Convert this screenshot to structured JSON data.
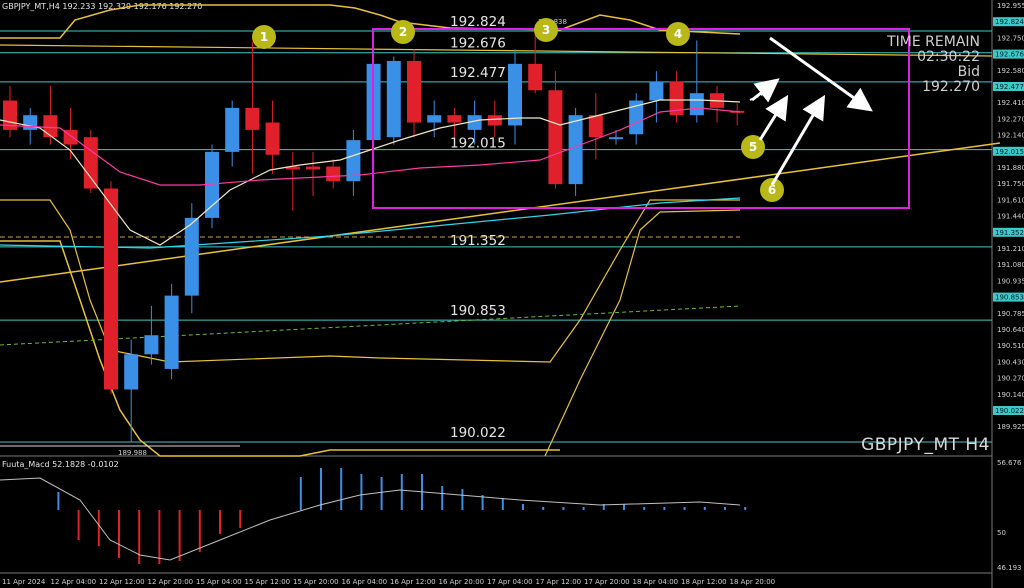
{
  "header": {
    "symbol_info": "GBPJPY_MT,H4",
    "ohlc": "192.233 192.329 192.176 192.270"
  },
  "indicator_header": {
    "name": "Fuuta_Macd",
    "values": "52.1828  -0.0102"
  },
  "info_panel": {
    "title": "TIME REMAIN",
    "countdown": "02:30:22",
    "bid_label": "Bid",
    "bid_value": "192.270"
  },
  "symbol_label": "GBPJPY_MT H4",
  "level_labels": [
    "192.824",
    "192.676",
    "192.477",
    "192.015",
    "191.352",
    "190.853",
    "190.022"
  ],
  "small_labels": {
    "top_peak": "192.838",
    "bottom_low": "189.988"
  },
  "price_axis": [
    "192.955",
    "192.824",
    "192.750",
    "192.676",
    "192.580",
    "192.477",
    "192.410",
    "192.270",
    "192.140",
    "192.015",
    "191.880",
    "191.750",
    "191.610",
    "191.440",
    "191.352",
    "191.210",
    "191.080",
    "190.935",
    "190.853",
    "190.785",
    "190.640",
    "190.510",
    "190.430",
    "190.270",
    "190.140",
    "190.022",
    "189.925"
  ],
  "indicator_axis": [
    "56.676",
    "50",
    "46.193"
  ],
  "time_axis": [
    "11 Apr 2024",
    "12 Apr 04:00",
    "12 Apr 12:00",
    "12 Apr 20:00",
    "15 Apr 04:00",
    "15 Apr 12:00",
    "15 Apr 20:00",
    "16 Apr 04:00",
    "16 Apr 12:00",
    "16 Apr 20:00",
    "17 Apr 04:00",
    "17 Apr 12:00",
    "17 Apr 20:00",
    "18 Apr 04:00",
    "18 Apr 12:00",
    "18 Apr 20:00"
  ],
  "markers": [
    "1",
    "2",
    "3",
    "4",
    "5",
    "6"
  ],
  "colors": {
    "bull": "#3a8fe6",
    "bear": "#e0202a",
    "level_line": "#3fc8c8",
    "box": "#e020e0",
    "marker": "#b8b818",
    "trend": "#e6c23a"
  },
  "chart_data": {
    "type": "candlestick",
    "symbol": "GBPJPY_MT",
    "timeframe": "H4",
    "candles": [
      {
        "o": 192.35,
        "h": 192.45,
        "l": 192.1,
        "c": 192.15
      },
      {
        "o": 192.15,
        "h": 192.3,
        "l": 192.05,
        "c": 192.25
      },
      {
        "o": 192.25,
        "h": 192.45,
        "l": 192.05,
        "c": 192.1
      },
      {
        "o": 192.15,
        "h": 192.3,
        "l": 191.95,
        "c": 192.05
      },
      {
        "o": 192.1,
        "h": 192.15,
        "l": 191.72,
        "c": 191.75
      },
      {
        "o": 191.75,
        "h": 191.8,
        "l": 190.35,
        "c": 190.38
      },
      {
        "o": 190.38,
        "h": 190.72,
        "l": 190.02,
        "c": 190.62
      },
      {
        "o": 190.62,
        "h": 190.95,
        "l": 190.55,
        "c": 190.75
      },
      {
        "o": 190.52,
        "h": 191.1,
        "l": 190.45,
        "c": 191.02
      },
      {
        "o": 191.02,
        "h": 191.65,
        "l": 190.9,
        "c": 191.55
      },
      {
        "o": 191.55,
        "h": 192.05,
        "l": 191.48,
        "c": 192.0
      },
      {
        "o": 192.0,
        "h": 192.35,
        "l": 191.9,
        "c": 192.3
      },
      {
        "o": 192.3,
        "h": 192.75,
        "l": 191.85,
        "c": 192.15
      },
      {
        "o": 192.2,
        "h": 192.35,
        "l": 191.85,
        "c": 191.98
      },
      {
        "o": 191.9,
        "h": 192.0,
        "l": 191.6,
        "c": 191.88
      },
      {
        "o": 191.9,
        "h": 192.0,
        "l": 191.7,
        "c": 191.88
      },
      {
        "o": 191.9,
        "h": 191.95,
        "l": 191.75,
        "c": 191.8
      },
      {
        "o": 191.8,
        "h": 192.15,
        "l": 191.7,
        "c": 192.08
      },
      {
        "o": 192.08,
        "h": 192.45,
        "l": 191.8,
        "c": 192.6
      },
      {
        "o": 192.1,
        "h": 192.65,
        "l": 192.05,
        "c": 192.62
      },
      {
        "o": 192.62,
        "h": 192.7,
        "l": 192.1,
        "c": 192.2
      },
      {
        "o": 192.2,
        "h": 192.35,
        "l": 192.1,
        "c": 192.25
      },
      {
        "o": 192.25,
        "h": 192.3,
        "l": 192.1,
        "c": 192.2
      },
      {
        "o": 192.15,
        "h": 192.35,
        "l": 192.05,
        "c": 192.25
      },
      {
        "o": 192.25,
        "h": 192.35,
        "l": 192.1,
        "c": 192.18
      },
      {
        "o": 192.18,
        "h": 192.7,
        "l": 192.05,
        "c": 192.6
      },
      {
        "o": 192.6,
        "h": 192.84,
        "l": 192.4,
        "c": 192.42
      },
      {
        "o": 192.42,
        "h": 192.55,
        "l": 191.75,
        "c": 191.78
      },
      {
        "o": 191.78,
        "h": 192.3,
        "l": 191.7,
        "c": 192.25
      },
      {
        "o": 192.25,
        "h": 192.4,
        "l": 191.95,
        "c": 192.1
      },
      {
        "o": 192.1,
        "h": 192.15,
        "l": 192.05,
        "c": 192.1
      },
      {
        "o": 192.12,
        "h": 192.4,
        "l": 192.05,
        "c": 192.35
      },
      {
        "o": 192.35,
        "h": 192.55,
        "l": 192.2,
        "c": 192.48
      },
      {
        "o": 192.48,
        "h": 192.55,
        "l": 192.2,
        "c": 192.25
      },
      {
        "o": 192.25,
        "h": 192.76,
        "l": 192.2,
        "c": 192.4
      },
      {
        "o": 192.4,
        "h": 192.45,
        "l": 192.2,
        "c": 192.3
      },
      {
        "o": 192.28,
        "h": 192.33,
        "l": 192.18,
        "c": 192.27
      }
    ],
    "levels": [
      192.824,
      192.676,
      192.477,
      192.015,
      191.352,
      190.853,
      190.022
    ],
    "macd_histogram": [
      0,
      0,
      0.3,
      -0.5,
      -0.6,
      -0.8,
      -0.9,
      -0.9,
      -0.85,
      -0.7,
      -0.4,
      -0.3,
      0,
      0,
      0.55,
      0.7,
      0.7,
      0.6,
      0.55,
      0.6,
      0.6,
      0.4,
      0.35,
      0.25,
      0.2,
      0.1,
      0.05,
      0.05,
      0.05,
      0.1,
      0.1,
      0.05,
      0.05,
      0.05,
      0.05,
      0.05,
      0.05
    ]
  }
}
